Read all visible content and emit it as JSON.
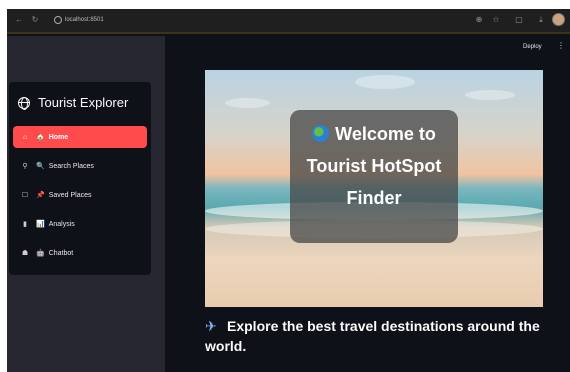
{
  "browser": {
    "url": "localhost:8501"
  },
  "header": {
    "deploy_label": "Deploy",
    "menu_glyph": "⋮"
  },
  "sidebar": {
    "title": "Tourist Explorer",
    "items": [
      {
        "icon": "home-icon",
        "glyph": "⌂",
        "emoji": "🏠",
        "label": "Home",
        "active": true
      },
      {
        "icon": "search-icon",
        "glyph": "⚲",
        "emoji": "🔍",
        "label": "Search Places",
        "active": false
      },
      {
        "icon": "bookmark-icon",
        "glyph": "☐",
        "emoji": "📌",
        "label": "Saved Places",
        "active": false
      },
      {
        "icon": "bar-chart-icon",
        "glyph": "▮",
        "emoji": "📊",
        "label": "Analysis",
        "active": false
      },
      {
        "icon": "robot-icon",
        "glyph": "☗",
        "emoji": "🤖",
        "label": "Chatbot",
        "active": false
      }
    ]
  },
  "main": {
    "banner_title": "Welcome to Tourist HotSpot Finder",
    "banner_title_lines": [
      "Welcome to",
      "Tourist HotSpot",
      "Finder"
    ],
    "tagline": "Explore the best travel destinations around the world.",
    "tagline_icon": "airplane-icon"
  },
  "colors": {
    "accent": "#ff4b4b",
    "background": "#0e1117",
    "sidebar": "#262730"
  }
}
